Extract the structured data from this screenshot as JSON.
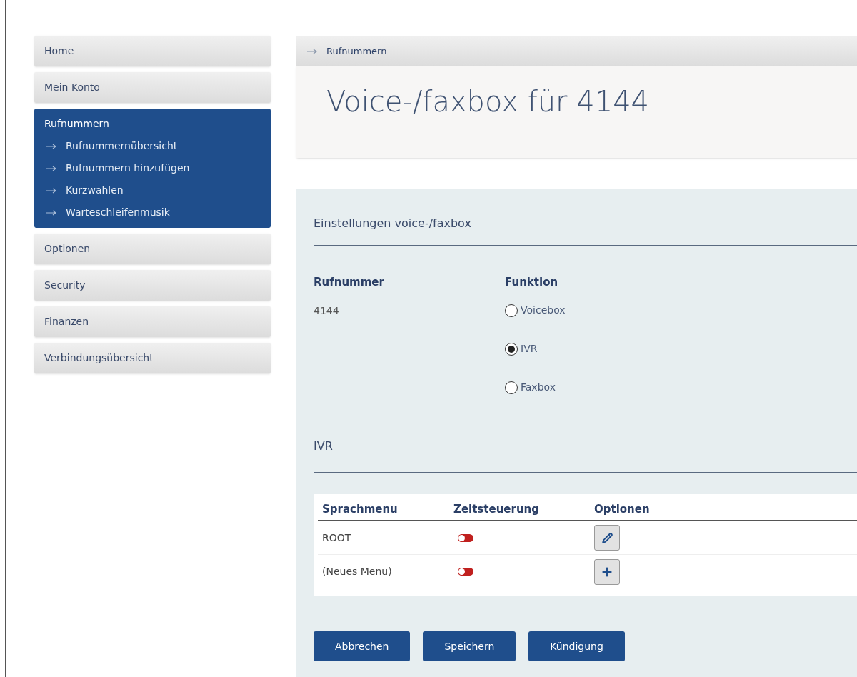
{
  "sidebar": {
    "items": [
      {
        "label": "Home",
        "selected": false
      },
      {
        "label": "Mein Konto",
        "selected": false
      },
      {
        "label": "Rufnummern",
        "selected": true,
        "children": [
          {
            "label": "Rufnummernübersicht"
          },
          {
            "label": "Rufnummern hinzufügen"
          },
          {
            "label": "Kurzwahlen"
          },
          {
            "label": "Warteschleifenmusik"
          }
        ]
      },
      {
        "label": "Optionen",
        "selected": false
      },
      {
        "label": "Security",
        "selected": false
      },
      {
        "label": "Finanzen",
        "selected": false
      },
      {
        "label": "Verbindungsübersicht",
        "selected": false
      }
    ]
  },
  "breadcrumb": "Rufnummern",
  "title": "Voice-/faxbox für 4144",
  "settings": {
    "heading": "Einstellungen voice-/faxbox",
    "number_label": "Rufnummer",
    "number": "4144",
    "function_label": "Funktion",
    "functions": [
      {
        "label": "Voicebox",
        "selected": false
      },
      {
        "label": "IVR",
        "selected": true
      },
      {
        "label": "Faxbox",
        "selected": false
      }
    ]
  },
  "ivr": {
    "heading": "IVR",
    "columns": [
      "Sprachmenu",
      "Zeitsteuerung",
      "Optionen"
    ],
    "rows": [
      {
        "name": "ROOT",
        "timed": false,
        "action": {
          "kind": "edit"
        }
      },
      {
        "name": "(Neues Menu)",
        "timed": false,
        "action": {
          "kind": "add"
        }
      }
    ]
  },
  "buttons": [
    "Abbrechen",
    "Speichern",
    "Kündigung"
  ]
}
